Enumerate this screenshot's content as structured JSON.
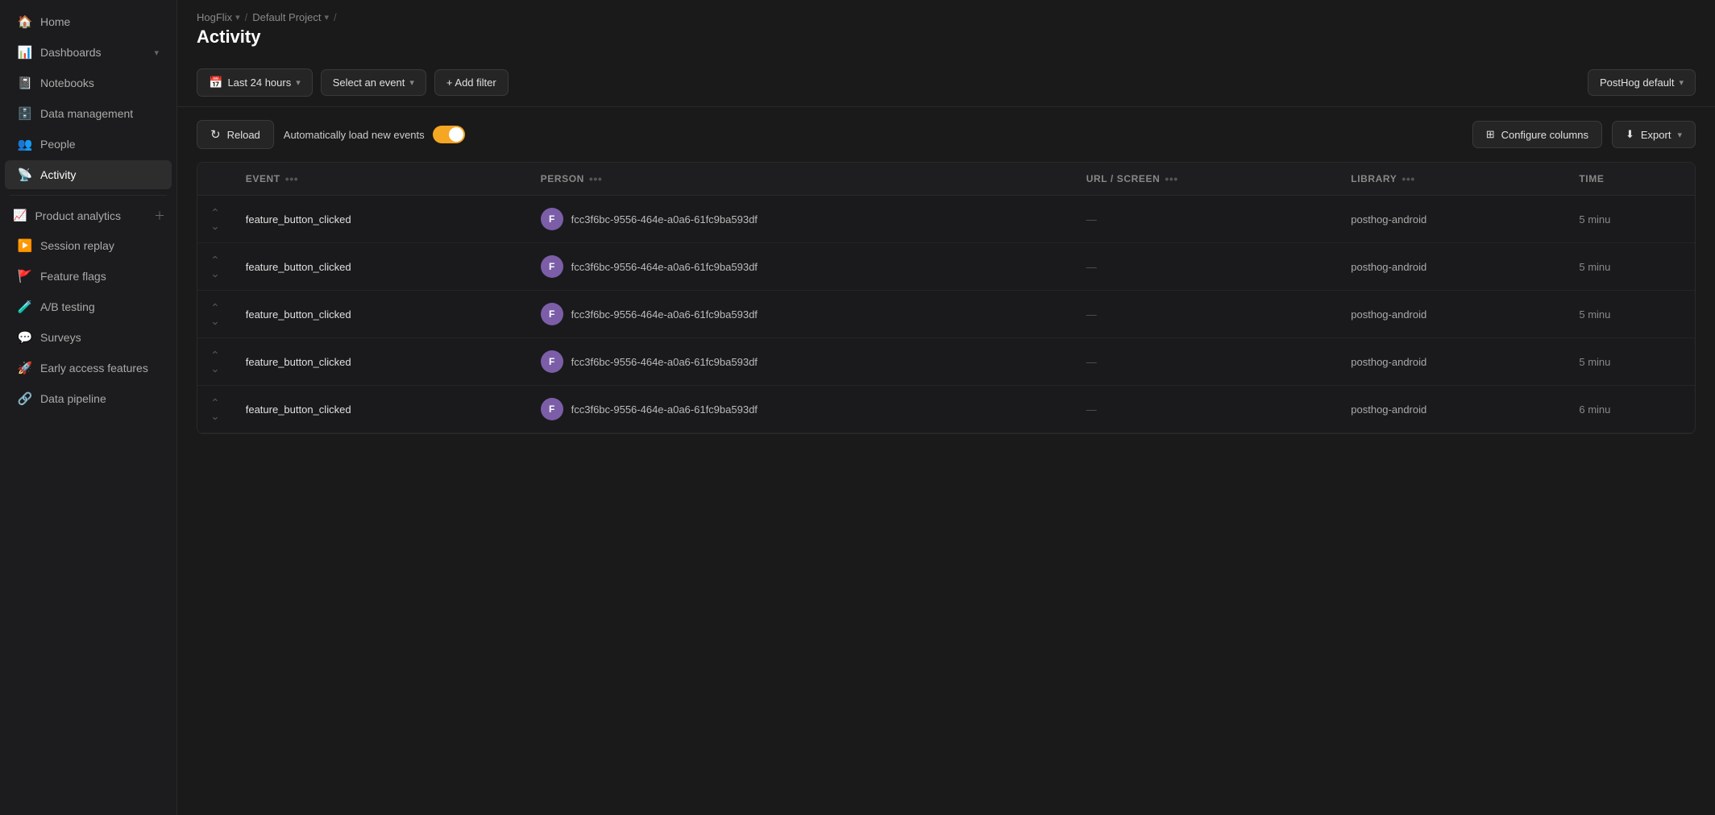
{
  "sidebar": {
    "items": [
      {
        "id": "home",
        "label": "Home",
        "icon": "🏠",
        "active": false
      },
      {
        "id": "dashboards",
        "label": "Dashboards",
        "icon": "📊",
        "active": false,
        "hasChevron": true
      },
      {
        "id": "notebooks",
        "label": "Notebooks",
        "icon": "📓",
        "active": false
      },
      {
        "id": "data-management",
        "label": "Data management",
        "icon": "🗄️",
        "active": false
      },
      {
        "id": "people",
        "label": "People",
        "icon": "👥",
        "active": false
      },
      {
        "id": "activity",
        "label": "Activity",
        "icon": "📡",
        "active": true
      },
      {
        "id": "product-analytics",
        "label": "Product analytics",
        "icon": "📈",
        "active": false,
        "hasAdd": true
      },
      {
        "id": "session-replay",
        "label": "Session replay",
        "icon": "▶️",
        "active": false
      },
      {
        "id": "feature-flags",
        "label": "Feature flags",
        "icon": "🚩",
        "active": false
      },
      {
        "id": "ab-testing",
        "label": "A/B testing",
        "icon": "🧪",
        "active": false
      },
      {
        "id": "surveys",
        "label": "Surveys",
        "icon": "💬",
        "active": false
      },
      {
        "id": "early-access",
        "label": "Early access features",
        "icon": "🚀",
        "active": false
      },
      {
        "id": "data-pipeline",
        "label": "Data pipeline",
        "icon": "🔗",
        "active": false
      }
    ]
  },
  "breadcrumb": {
    "items": [
      {
        "label": "HogFlix",
        "hasChevron": true
      },
      {
        "label": "Default Project",
        "hasChevron": true
      }
    ]
  },
  "page": {
    "title": "Activity"
  },
  "toolbar": {
    "time_filter": "Last 24 hours",
    "event_filter": "Select an event",
    "add_filter_label": "+ Add filter",
    "cluster_label": "PostHog default",
    "reload_label": "Reload",
    "auto_load_label": "Automatically load new events",
    "configure_columns_label": "Configure columns",
    "export_label": "Export"
  },
  "table": {
    "columns": [
      {
        "id": "expand",
        "label": ""
      },
      {
        "id": "event",
        "label": "EVENT",
        "hasMore": true
      },
      {
        "id": "person",
        "label": "PERSON",
        "hasMore": true
      },
      {
        "id": "url_screen",
        "label": "URL / SCREEN",
        "hasMore": true
      },
      {
        "id": "library",
        "label": "LIBRARY",
        "hasMore": true
      },
      {
        "id": "time",
        "label": "TIME"
      }
    ],
    "rows": [
      {
        "event": "feature_button_clicked",
        "person_avatar": "F",
        "person_id": "fcc3f6bc-9556-464e-a0a6-61fc9ba593df",
        "url_screen": "—",
        "library": "posthog-android",
        "time": "5 minu"
      },
      {
        "event": "feature_button_clicked",
        "person_avatar": "F",
        "person_id": "fcc3f6bc-9556-464e-a0a6-61fc9ba593df",
        "url_screen": "—",
        "library": "posthog-android",
        "time": "5 minu"
      },
      {
        "event": "feature_button_clicked",
        "person_avatar": "F",
        "person_id": "fcc3f6bc-9556-464e-a0a6-61fc9ba593df",
        "url_screen": "—",
        "library": "posthog-android",
        "time": "5 minu"
      },
      {
        "event": "feature_button_clicked",
        "person_avatar": "F",
        "person_id": "fcc3f6bc-9556-464e-a0a6-61fc9ba593df",
        "url_screen": "—",
        "library": "posthog-android",
        "time": "5 minu"
      },
      {
        "event": "feature_button_clicked",
        "person_avatar": "F",
        "person_id": "fcc3f6bc-9556-464e-a0a6-61fc9ba593df",
        "url_screen": "—",
        "library": "posthog-android",
        "time": "6 minu"
      }
    ]
  }
}
